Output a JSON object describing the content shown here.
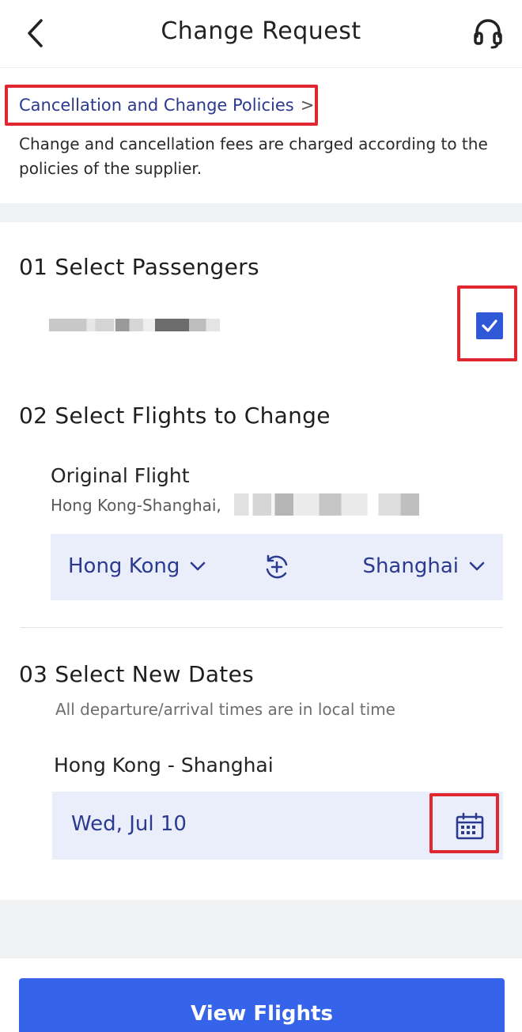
{
  "header": {
    "title": "Change Request",
    "back_icon": "chevron-left-icon",
    "support_icon": "headset-icon"
  },
  "policy": {
    "link_label": "Cancellation and Change Policies",
    "link_chevron": ">",
    "description": "Change and cancellation fees are charged according to the policies of the supplier."
  },
  "passengers": {
    "title": "01 Select Passengers",
    "checked": true
  },
  "flights": {
    "title": "02 Select Flights to Change",
    "original_label": "Original Flight",
    "original_route": "Hong Kong-Shanghai,",
    "from_city": "Hong Kong",
    "to_city": "Shanghai"
  },
  "dates": {
    "title": "03 Select New Dates",
    "timezone_note": "All departure/arrival times are in local time",
    "route": "Hong Kong - Shanghai",
    "date_value": "Wed, Jul 10"
  },
  "footer": {
    "button_label": "View Flights"
  },
  "colors": {
    "accent": "#3564ea",
    "link": "#2b3a8f",
    "highlight": "#e0262e",
    "field_bg": "#eaeefa"
  }
}
